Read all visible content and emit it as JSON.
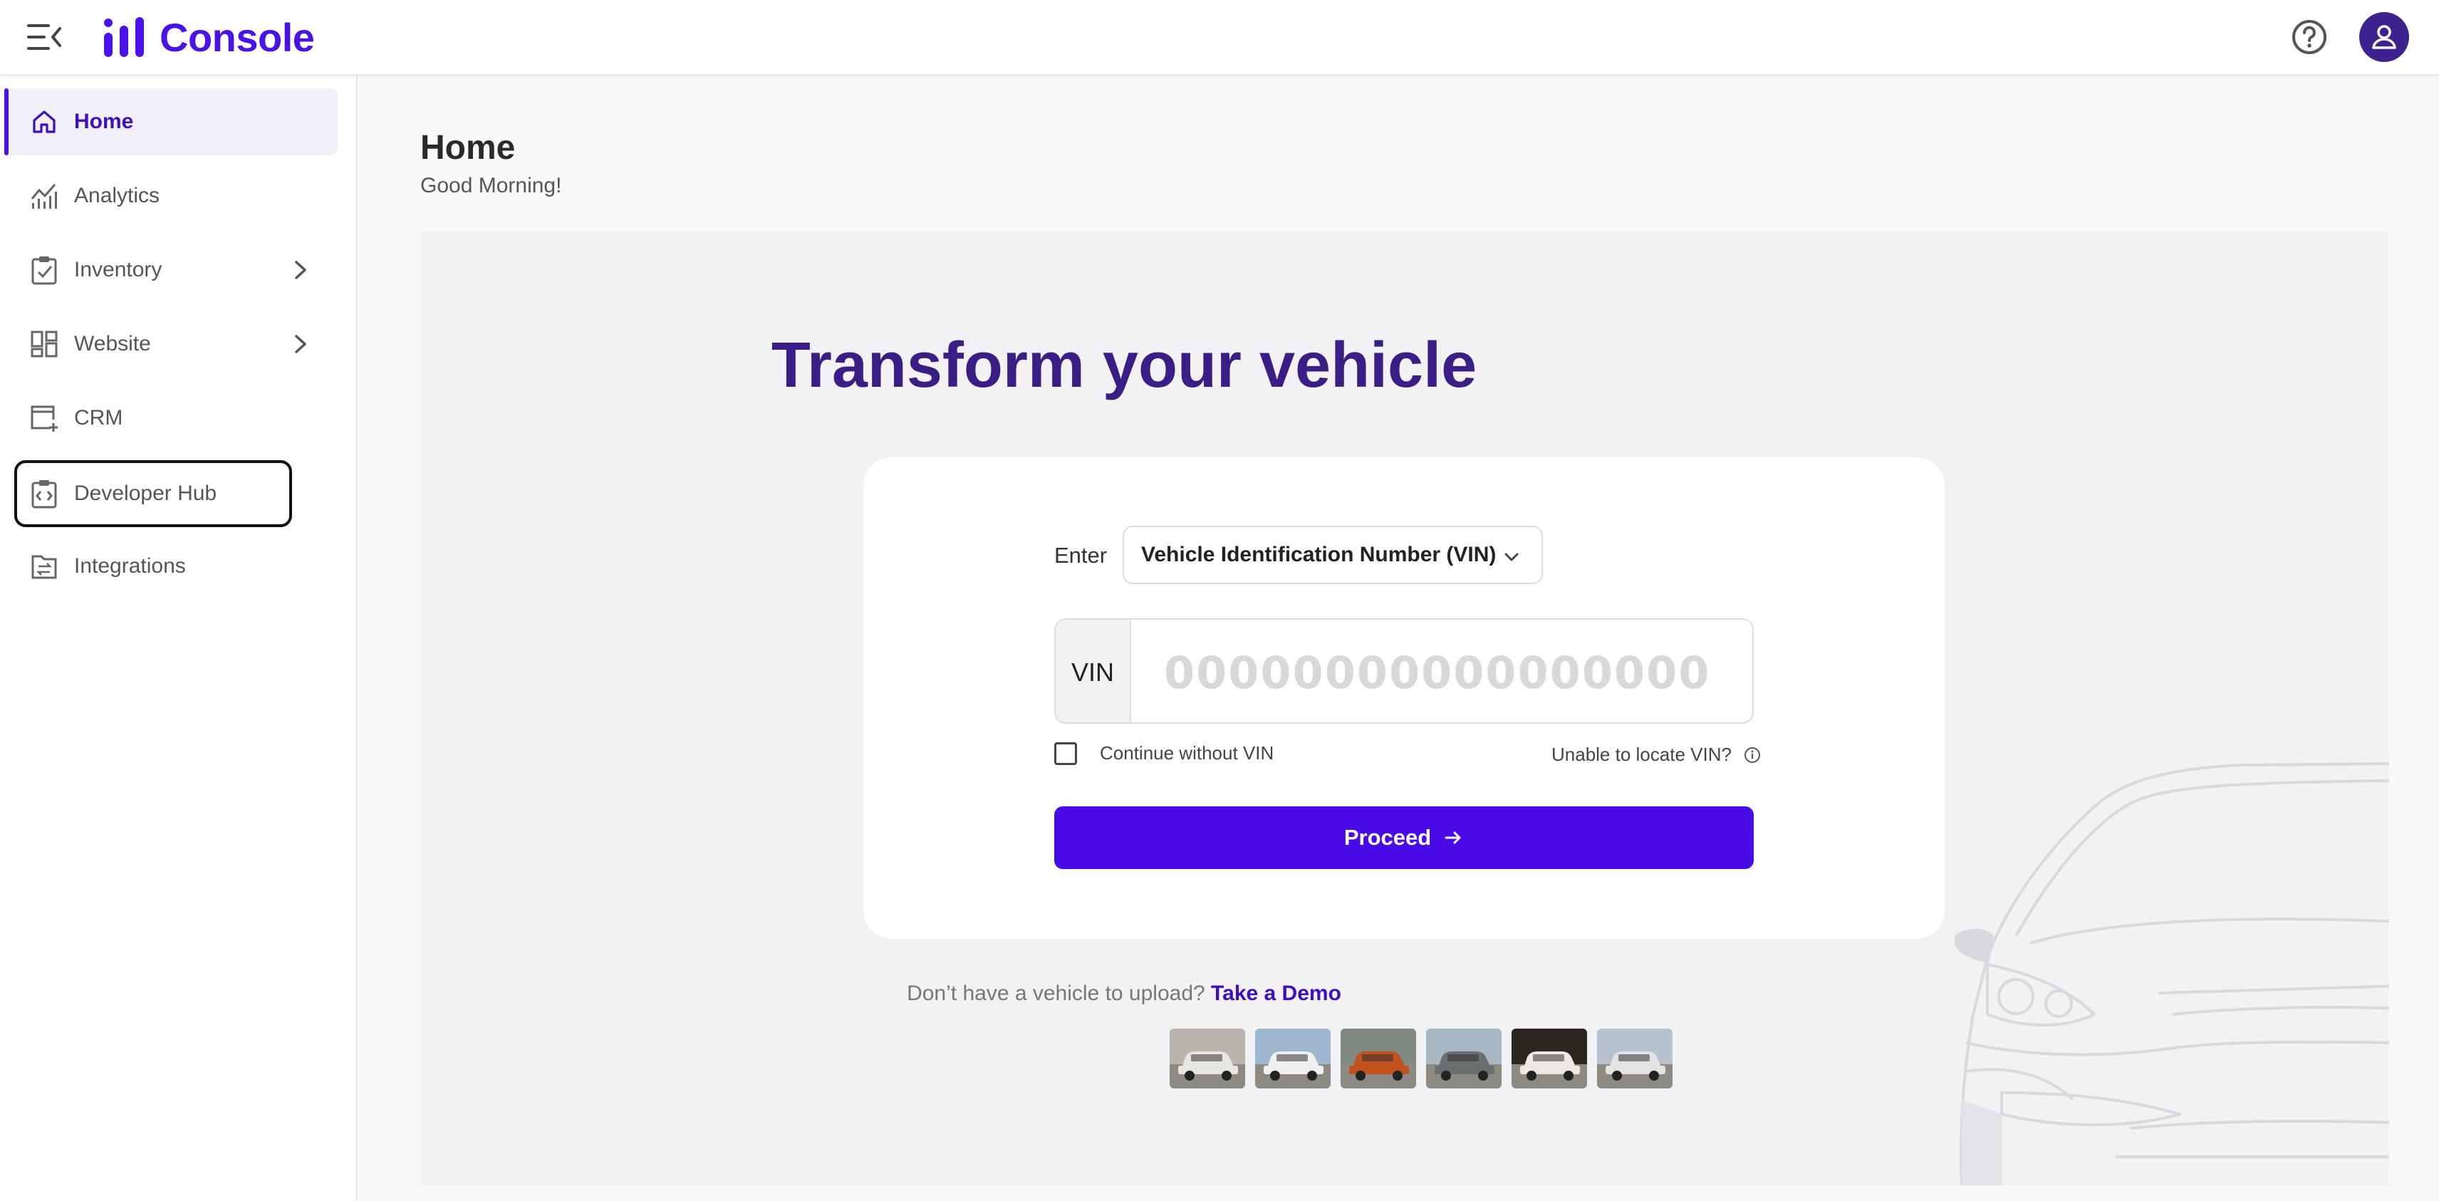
{
  "app": {
    "title": "Console",
    "brand_color": "#4a12e6"
  },
  "header": {
    "menu_icon": "menu-collapse-icon",
    "help_icon": "help-circle-icon",
    "user_icon": "user-icon"
  },
  "sidebar": {
    "items": [
      {
        "label": "Home",
        "icon": "home-icon",
        "active": true
      },
      {
        "label": "Analytics",
        "icon": "analytics-icon"
      },
      {
        "label": "Inventory",
        "icon": "clipboard-check-icon",
        "has_children": true
      },
      {
        "label": "Website",
        "icon": "dashboard-grid-icon",
        "has_children": true
      },
      {
        "label": "CRM",
        "icon": "window-plus-icon"
      },
      {
        "label": "Developer Hub",
        "icon": "code-clipboard-icon",
        "focused": true
      },
      {
        "label": "Integrations",
        "icon": "folder-swap-icon"
      }
    ]
  },
  "main": {
    "title": "Home",
    "subtitle": "Good Morning!",
    "hero_title": "Transform your vehicle",
    "form": {
      "enter_label": "Enter",
      "identifier_select": "Vehicle Identification Number (VIN)",
      "vin_prefix": "VIN",
      "vin_placeholder": "00000000000000000",
      "continue_without_label": "Continue without VIN",
      "continue_without_checked": false,
      "locate_link": "Unable to locate VIN?",
      "proceed_label": "Proceed"
    },
    "demo": {
      "prompt": "Don’t have a vehicle to upload?",
      "link": "Take a Demo",
      "thumbnails": [
        {
          "name": "white-jeep",
          "color": "#e8e6e2",
          "sky": "#b9b5ac"
        },
        {
          "name": "white-suv",
          "color": "#f0f0f0",
          "sky": "#9fb6cf"
        },
        {
          "name": "orange-crossover",
          "color": "#c2531e",
          "sky": "#7e8a80"
        },
        {
          "name": "gray-pickup",
          "color": "#6b6f70",
          "sky": "#a7b8c4"
        },
        {
          "name": "white-luxury-suv",
          "color": "#ece9e2",
          "sky": "#2a2620"
        },
        {
          "name": "silver-suv",
          "color": "#e3e3e3",
          "sky": "#b6c3cf"
        }
      ]
    }
  }
}
